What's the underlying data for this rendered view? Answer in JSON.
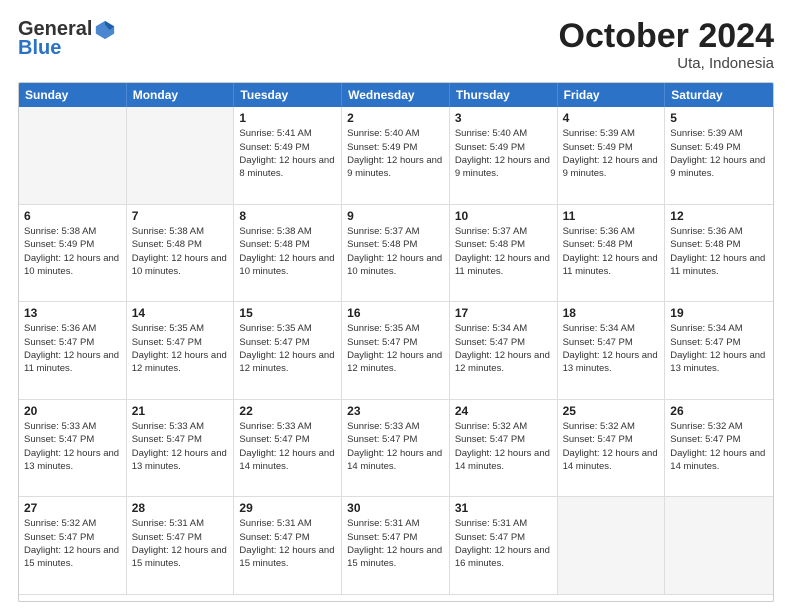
{
  "header": {
    "logo_general": "General",
    "logo_blue": "Blue",
    "month_title": "October 2024",
    "subtitle": "Uta, Indonesia"
  },
  "calendar": {
    "days_of_week": [
      "Sunday",
      "Monday",
      "Tuesday",
      "Wednesday",
      "Thursday",
      "Friday",
      "Saturday"
    ],
    "weeks": [
      [
        {
          "day": "",
          "sunrise": "",
          "sunset": "",
          "daylight": ""
        },
        {
          "day": "",
          "sunrise": "",
          "sunset": "",
          "daylight": ""
        },
        {
          "day": "1",
          "sunrise": "Sunrise: 5:41 AM",
          "sunset": "Sunset: 5:49 PM",
          "daylight": "Daylight: 12 hours and 8 minutes."
        },
        {
          "day": "2",
          "sunrise": "Sunrise: 5:40 AM",
          "sunset": "Sunset: 5:49 PM",
          "daylight": "Daylight: 12 hours and 9 minutes."
        },
        {
          "day": "3",
          "sunrise": "Sunrise: 5:40 AM",
          "sunset": "Sunset: 5:49 PM",
          "daylight": "Daylight: 12 hours and 9 minutes."
        },
        {
          "day": "4",
          "sunrise": "Sunrise: 5:39 AM",
          "sunset": "Sunset: 5:49 PM",
          "daylight": "Daylight: 12 hours and 9 minutes."
        },
        {
          "day": "5",
          "sunrise": "Sunrise: 5:39 AM",
          "sunset": "Sunset: 5:49 PM",
          "daylight": "Daylight: 12 hours and 9 minutes."
        }
      ],
      [
        {
          "day": "6",
          "sunrise": "Sunrise: 5:38 AM",
          "sunset": "Sunset: 5:49 PM",
          "daylight": "Daylight: 12 hours and 10 minutes."
        },
        {
          "day": "7",
          "sunrise": "Sunrise: 5:38 AM",
          "sunset": "Sunset: 5:48 PM",
          "daylight": "Daylight: 12 hours and 10 minutes."
        },
        {
          "day": "8",
          "sunrise": "Sunrise: 5:38 AM",
          "sunset": "Sunset: 5:48 PM",
          "daylight": "Daylight: 12 hours and 10 minutes."
        },
        {
          "day": "9",
          "sunrise": "Sunrise: 5:37 AM",
          "sunset": "Sunset: 5:48 PM",
          "daylight": "Daylight: 12 hours and 10 minutes."
        },
        {
          "day": "10",
          "sunrise": "Sunrise: 5:37 AM",
          "sunset": "Sunset: 5:48 PM",
          "daylight": "Daylight: 12 hours and 11 minutes."
        },
        {
          "day": "11",
          "sunrise": "Sunrise: 5:36 AM",
          "sunset": "Sunset: 5:48 PM",
          "daylight": "Daylight: 12 hours and 11 minutes."
        },
        {
          "day": "12",
          "sunrise": "Sunrise: 5:36 AM",
          "sunset": "Sunset: 5:48 PM",
          "daylight": "Daylight: 12 hours and 11 minutes."
        }
      ],
      [
        {
          "day": "13",
          "sunrise": "Sunrise: 5:36 AM",
          "sunset": "Sunset: 5:47 PM",
          "daylight": "Daylight: 12 hours and 11 minutes."
        },
        {
          "day": "14",
          "sunrise": "Sunrise: 5:35 AM",
          "sunset": "Sunset: 5:47 PM",
          "daylight": "Daylight: 12 hours and 12 minutes."
        },
        {
          "day": "15",
          "sunrise": "Sunrise: 5:35 AM",
          "sunset": "Sunset: 5:47 PM",
          "daylight": "Daylight: 12 hours and 12 minutes."
        },
        {
          "day": "16",
          "sunrise": "Sunrise: 5:35 AM",
          "sunset": "Sunset: 5:47 PM",
          "daylight": "Daylight: 12 hours and 12 minutes."
        },
        {
          "day": "17",
          "sunrise": "Sunrise: 5:34 AM",
          "sunset": "Sunset: 5:47 PM",
          "daylight": "Daylight: 12 hours and 12 minutes."
        },
        {
          "day": "18",
          "sunrise": "Sunrise: 5:34 AM",
          "sunset": "Sunset: 5:47 PM",
          "daylight": "Daylight: 12 hours and 13 minutes."
        },
        {
          "day": "19",
          "sunrise": "Sunrise: 5:34 AM",
          "sunset": "Sunset: 5:47 PM",
          "daylight": "Daylight: 12 hours and 13 minutes."
        }
      ],
      [
        {
          "day": "20",
          "sunrise": "Sunrise: 5:33 AM",
          "sunset": "Sunset: 5:47 PM",
          "daylight": "Daylight: 12 hours and 13 minutes."
        },
        {
          "day": "21",
          "sunrise": "Sunrise: 5:33 AM",
          "sunset": "Sunset: 5:47 PM",
          "daylight": "Daylight: 12 hours and 13 minutes."
        },
        {
          "day": "22",
          "sunrise": "Sunrise: 5:33 AM",
          "sunset": "Sunset: 5:47 PM",
          "daylight": "Daylight: 12 hours and 14 minutes."
        },
        {
          "day": "23",
          "sunrise": "Sunrise: 5:33 AM",
          "sunset": "Sunset: 5:47 PM",
          "daylight": "Daylight: 12 hours and 14 minutes."
        },
        {
          "day": "24",
          "sunrise": "Sunrise: 5:32 AM",
          "sunset": "Sunset: 5:47 PM",
          "daylight": "Daylight: 12 hours and 14 minutes."
        },
        {
          "day": "25",
          "sunrise": "Sunrise: 5:32 AM",
          "sunset": "Sunset: 5:47 PM",
          "daylight": "Daylight: 12 hours and 14 minutes."
        },
        {
          "day": "26",
          "sunrise": "Sunrise: 5:32 AM",
          "sunset": "Sunset: 5:47 PM",
          "daylight": "Daylight: 12 hours and 14 minutes."
        }
      ],
      [
        {
          "day": "27",
          "sunrise": "Sunrise: 5:32 AM",
          "sunset": "Sunset: 5:47 PM",
          "daylight": "Daylight: 12 hours and 15 minutes."
        },
        {
          "day": "28",
          "sunrise": "Sunrise: 5:31 AM",
          "sunset": "Sunset: 5:47 PM",
          "daylight": "Daylight: 12 hours and 15 minutes."
        },
        {
          "day": "29",
          "sunrise": "Sunrise: 5:31 AM",
          "sunset": "Sunset: 5:47 PM",
          "daylight": "Daylight: 12 hours and 15 minutes."
        },
        {
          "day": "30",
          "sunrise": "Sunrise: 5:31 AM",
          "sunset": "Sunset: 5:47 PM",
          "daylight": "Daylight: 12 hours and 15 minutes."
        },
        {
          "day": "31",
          "sunrise": "Sunrise: 5:31 AM",
          "sunset": "Sunset: 5:47 PM",
          "daylight": "Daylight: 12 hours and 16 minutes."
        },
        {
          "day": "",
          "sunrise": "",
          "sunset": "",
          "daylight": ""
        },
        {
          "day": "",
          "sunrise": "",
          "sunset": "",
          "daylight": ""
        }
      ]
    ]
  }
}
